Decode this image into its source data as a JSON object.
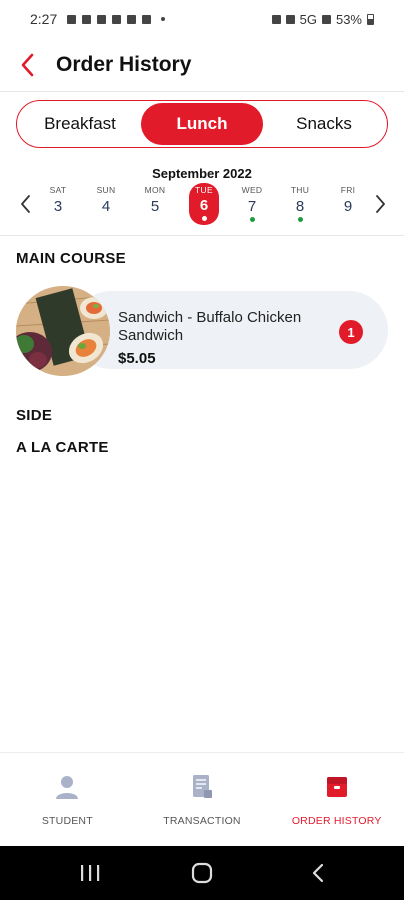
{
  "status_bar": {
    "time": "2:27",
    "network": "5G",
    "battery": "53%"
  },
  "header": {
    "title": "Order History",
    "back_icon": "chevron-left-icon"
  },
  "meal_tabs": [
    {
      "label": "Breakfast",
      "active": false
    },
    {
      "label": "Lunch",
      "active": true
    },
    {
      "label": "Snacks",
      "active": false
    }
  ],
  "calendar": {
    "month": "September 2022",
    "days": [
      {
        "dow": "SAT",
        "num": "3",
        "selected": false,
        "has_order": false
      },
      {
        "dow": "SUN",
        "num": "4",
        "selected": false,
        "has_order": false
      },
      {
        "dow": "MON",
        "num": "5",
        "selected": false,
        "has_order": false
      },
      {
        "dow": "TUE",
        "num": "6",
        "selected": true,
        "has_order": true
      },
      {
        "dow": "WED",
        "num": "7",
        "selected": false,
        "has_order": true
      },
      {
        "dow": "THU",
        "num": "8",
        "selected": false,
        "has_order": true
      },
      {
        "dow": "FRI",
        "num": "9",
        "selected": false,
        "has_order": false
      }
    ]
  },
  "sections": {
    "main_course": "MAIN COURSE",
    "side": "SIDE",
    "a_la_carte": "A LA CARTE"
  },
  "order_items": [
    {
      "name": "Sandwich - Buffalo Chicken Sandwich",
      "price": "$5.05",
      "quantity": "1"
    }
  ],
  "bottom_nav": [
    {
      "label": "STUDENT",
      "icon": "person-icon",
      "active": false
    },
    {
      "label": "TRANSACTION",
      "icon": "receipt-icon",
      "active": false
    },
    {
      "label": "ORDER HISTORY",
      "icon": "order-box-icon",
      "active": true
    }
  ],
  "colors": {
    "accent": "#e21b2b",
    "order_marker": "#1f9a3e",
    "date_text": "#2a3a5c",
    "item_background": "#eef1f5"
  }
}
